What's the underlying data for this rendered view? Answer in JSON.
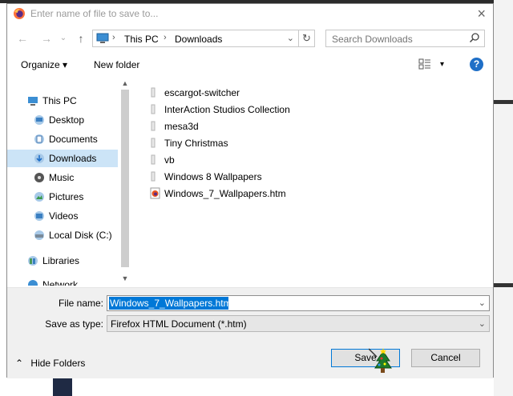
{
  "dialog": {
    "title": "Enter name of file to save to...",
    "close_label": "×"
  },
  "nav": {
    "back": "←",
    "forward": "→",
    "up": "↑"
  },
  "address": {
    "crumbs": [
      "This PC",
      "Downloads"
    ],
    "separator": "›",
    "dropdown": "⌄",
    "refresh": "↻"
  },
  "search": {
    "placeholder": "Search Downloads"
  },
  "toolbar": {
    "organize": "Organize ▾",
    "new_folder": "New folder",
    "view_dropdown": "▾",
    "help": "?"
  },
  "sidebar": {
    "items": [
      {
        "label": "This PC",
        "icon": "pc-icon"
      },
      {
        "label": "Desktop",
        "icon": "desktop-icon"
      },
      {
        "label": "Documents",
        "icon": "documents-icon"
      },
      {
        "label": "Downloads",
        "icon": "downloads-icon",
        "selected": true
      },
      {
        "label": "Music",
        "icon": "music-icon"
      },
      {
        "label": "Pictures",
        "icon": "pictures-icon"
      },
      {
        "label": "Videos",
        "icon": "videos-icon"
      },
      {
        "label": "Local Disk (C:)",
        "icon": "disk-icon"
      },
      {
        "label": "Libraries",
        "icon": "libraries-icon"
      },
      {
        "label": "Network",
        "icon": "network-icon"
      }
    ],
    "scroll_up": "▲",
    "scroll_down": "▼"
  },
  "files": [
    {
      "name": "escargot-switcher",
      "type": "folder"
    },
    {
      "name": "InterAction Studios Collection",
      "type": "folder"
    },
    {
      "name": "mesa3d",
      "type": "folder"
    },
    {
      "name": "Tiny Christmas",
      "type": "folder"
    },
    {
      "name": "vb",
      "type": "folder"
    },
    {
      "name": "Windows 8 Wallpapers",
      "type": "folder"
    },
    {
      "name": "Windows_7_Wallpapers.htm",
      "type": "htm"
    }
  ],
  "form": {
    "file_name_label": "File name:",
    "file_name_value": "Windows_7_Wallpapers.htm",
    "save_type_label": "Save as type:",
    "save_type_value": "Firefox HTML Document (*.htm)",
    "dropdown": "⌄"
  },
  "footer": {
    "hide_folders": "Hide Folders",
    "hide_folders_arrow": "⌃",
    "save": "Save",
    "cancel": "Cancel"
  },
  "colors": {
    "accent": "#0078d7",
    "selection_bg": "#cce4f7",
    "footer_bg": "#f0f0f0"
  }
}
